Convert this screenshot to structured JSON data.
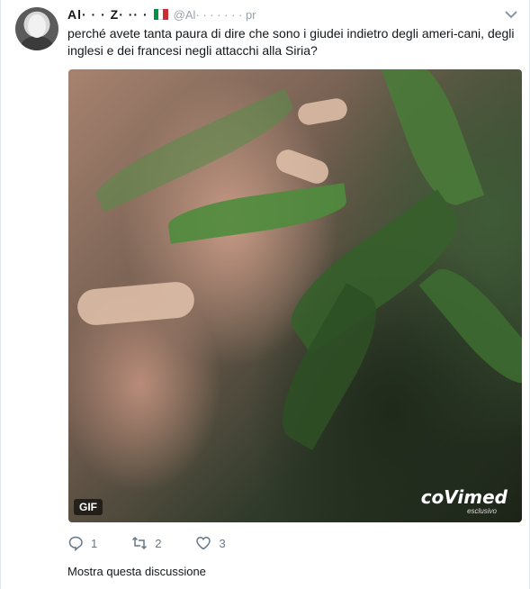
{
  "tweet": {
    "author_name": "Al·  ·  ·  Z· ·· ·",
    "handle": "@Al·  ·  ·  ·  ·  ·  ·  pr",
    "text": "perché avete tanta paura di dire che sono i giudei indietro degli ameri-cani, degli inglesi e dei francesi negli attacchi alla Siria?",
    "flag_colors": [
      "#009246",
      "#ffffff",
      "#ce2b37"
    ],
    "media": {
      "badge": "GIF",
      "watermark": "coVimed",
      "watermark_sub": "esclusivo"
    },
    "actions": {
      "replies": "1",
      "retweets": "2",
      "likes": "3"
    },
    "thread_link": "Mostra questa discussione"
  },
  "icons": {
    "caret": "chevron-down-icon",
    "reply": "reply-icon",
    "retweet": "retweet-icon",
    "like": "heart-icon"
  },
  "colors": {
    "text": "#14171a",
    "muted": "#657786",
    "caret": "#8899a6"
  }
}
